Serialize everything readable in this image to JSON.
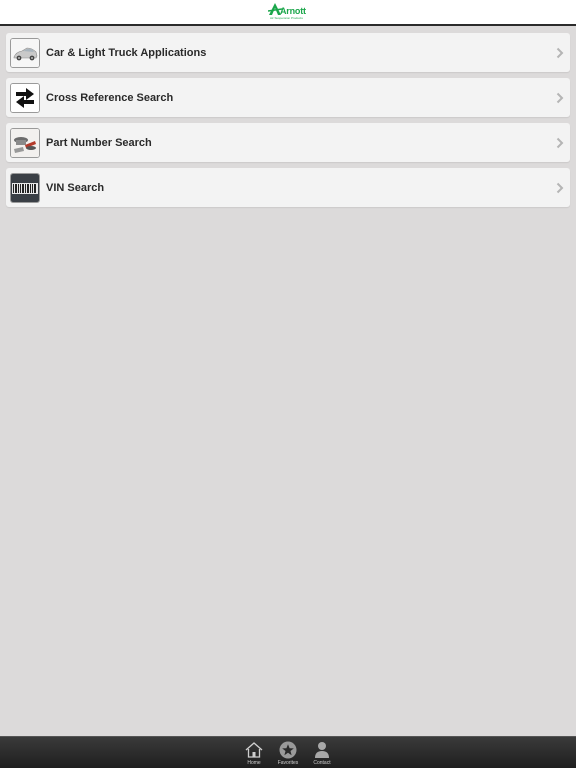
{
  "header": {
    "logo_text": "Arnott",
    "logo_tagline": "Air Suspension Products",
    "brand_color": "#1aa64a"
  },
  "menu": {
    "items": [
      {
        "label": "Car & Light Truck Applications",
        "icon": "car-icon"
      },
      {
        "label": "Cross Reference Search",
        "icon": "swap-arrows-icon"
      },
      {
        "label": "Part Number Search",
        "icon": "parts-icon"
      },
      {
        "label": "VIN Search",
        "icon": "barcode-icon"
      }
    ]
  },
  "tabbar": {
    "tabs": [
      {
        "label": "Home",
        "icon": "home-icon"
      },
      {
        "label": "Favorites",
        "icon": "star-icon"
      },
      {
        "label": "Contact",
        "icon": "person-icon"
      }
    ]
  }
}
